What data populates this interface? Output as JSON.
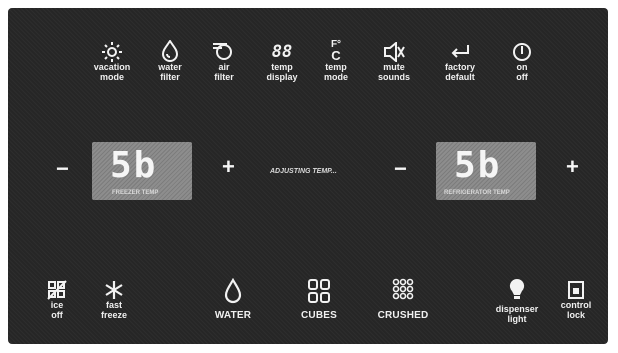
{
  "top_row": [
    {
      "icon": "sun-icon",
      "label": "vacation\nmode"
    },
    {
      "icon": "water-drop-icon",
      "label": "water\nfilter"
    },
    {
      "icon": "air-filter-icon",
      "label": "air\nfilter"
    },
    {
      "icon": "temp-display-icon",
      "label": "temp\ndisplay",
      "glyph": "88"
    },
    {
      "icon": "fahrenheit-celsius-icon",
      "label": "temp\nmode",
      "glyph_top": "F°",
      "glyph_bottom": "C"
    },
    {
      "icon": "speaker-mute-icon",
      "label": "mute\nsounds"
    },
    {
      "icon": "return-arrow-icon",
      "label": "factory\ndefault"
    },
    {
      "icon": "power-icon",
      "label": "on\noff"
    }
  ],
  "freezer": {
    "minus": "−",
    "plus": "+",
    "value": "5b",
    "label": "FREEZER TEMP"
  },
  "refrigerator": {
    "minus": "−",
    "plus": "+",
    "value": "5b",
    "label": "REFRIGERATOR TEMP"
  },
  "adjusting_text": "ADJUSTING TEMP...",
  "bottom_row": [
    {
      "icon": "ice-off-icon",
      "label": "ice\noff"
    },
    {
      "icon": "snowflake-icon",
      "label": "fast\nfreeze"
    },
    {
      "icon": "water-drop-icon",
      "label": "WATER"
    },
    {
      "icon": "cubes-icon",
      "label": "CUBES"
    },
    {
      "icon": "crushed-ice-icon",
      "label": "CRUSHED"
    },
    {
      "icon": "light-bulb-icon",
      "label": "dispenser\nlight"
    },
    {
      "icon": "lock-icon",
      "label": "control\nlock"
    }
  ]
}
